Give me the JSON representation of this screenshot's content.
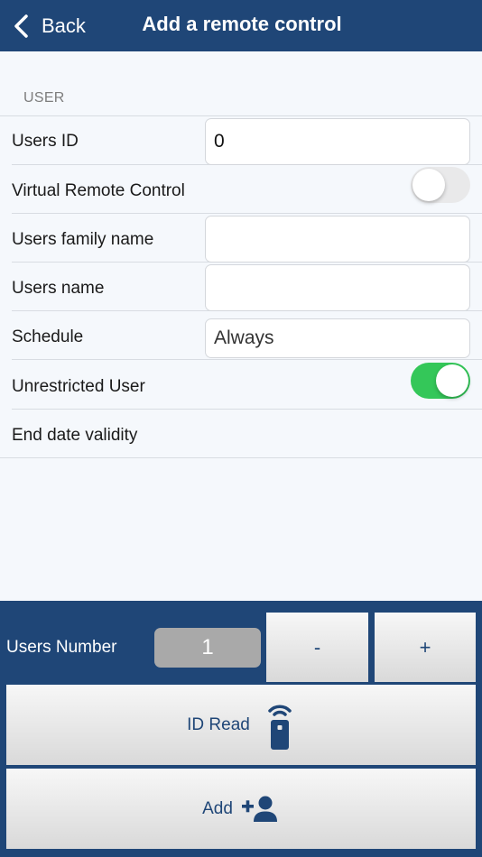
{
  "navbar": {
    "back_label": "Back",
    "title": "Add a remote control"
  },
  "section": {
    "header": "USER"
  },
  "form": {
    "users_id": {
      "label": "Users ID",
      "value": "0"
    },
    "virtual_remote": {
      "label": "Virtual Remote Control",
      "enabled": false
    },
    "family_name": {
      "label": "Users family name",
      "value": ""
    },
    "users_name": {
      "label": "Users name",
      "value": ""
    },
    "schedule": {
      "label": "Schedule",
      "value": "Always"
    },
    "unrestricted": {
      "label": "Unrestricted User",
      "enabled": true
    },
    "end_date": {
      "label": "End date validity"
    }
  },
  "bottom": {
    "users_number_label": "Users Number",
    "users_number_value": "1",
    "minus_label": "-",
    "plus_label": "+",
    "id_read_label": "ID Read",
    "add_label": "Add"
  },
  "colors": {
    "navbar": "#1f4677",
    "toggle_on": "#34c759",
    "toggle_off": "#e9e9ea",
    "button_text": "#1f4677"
  },
  "icons": {
    "back": "chevron-left-icon",
    "id_read": "remote-control-icon",
    "add": "add-user-icon"
  }
}
